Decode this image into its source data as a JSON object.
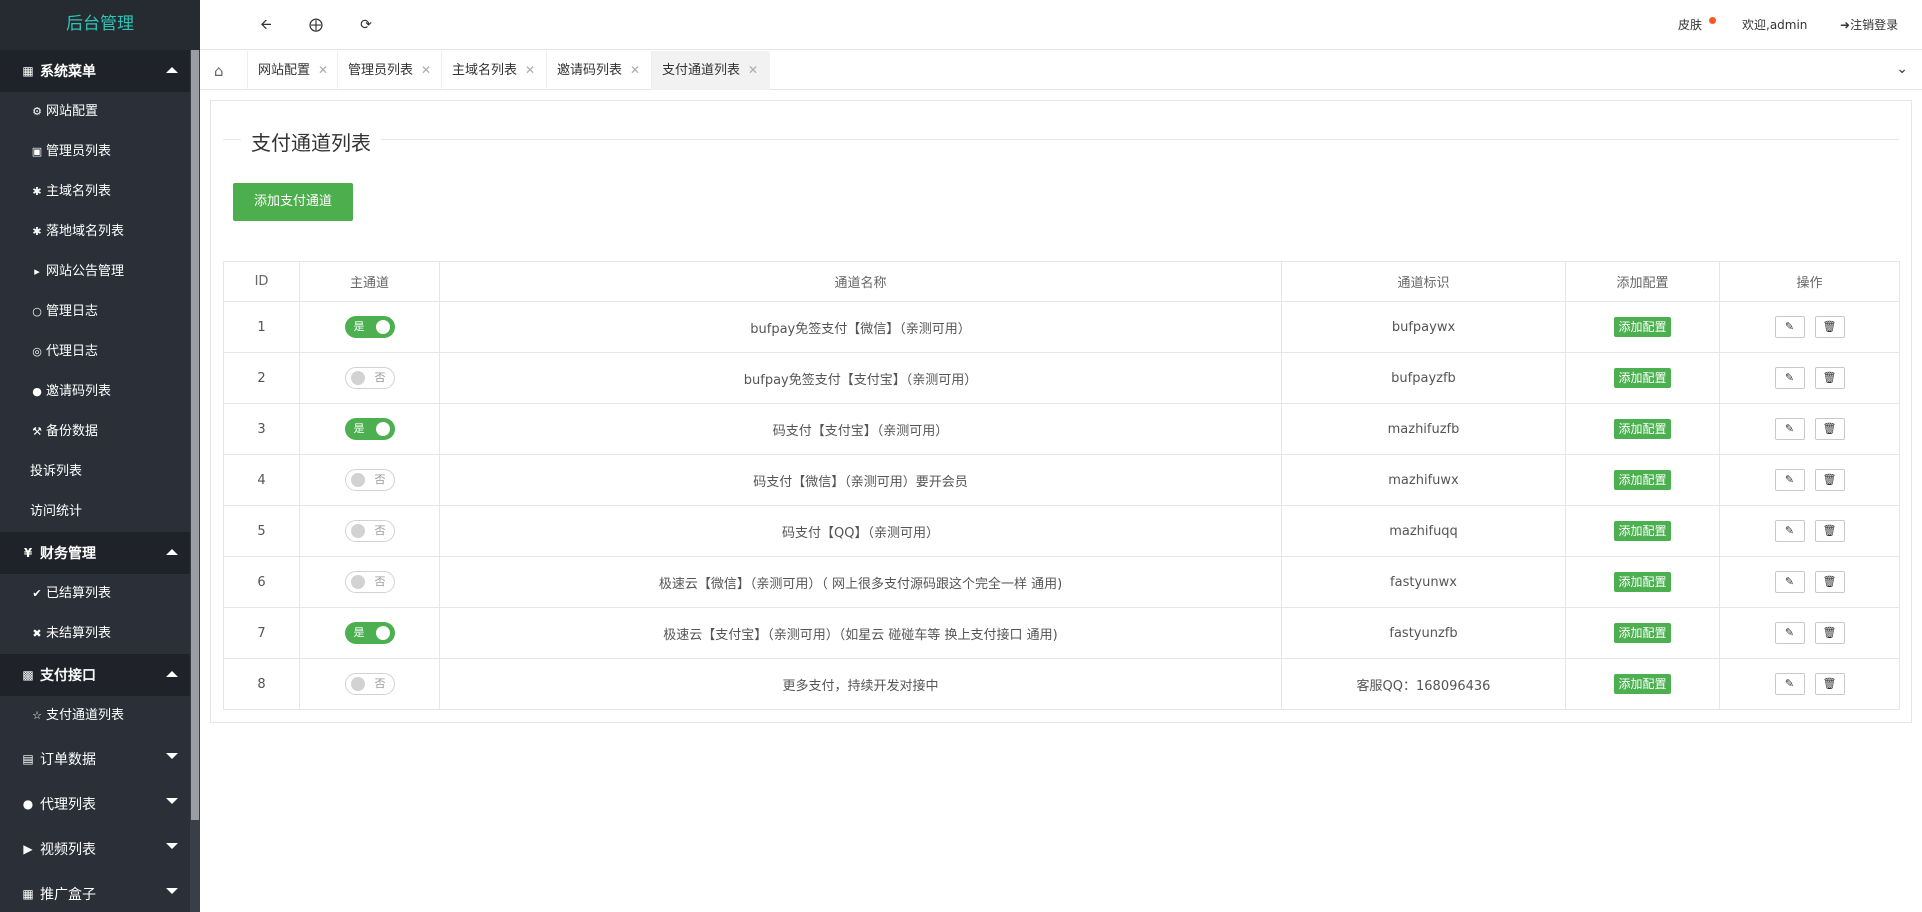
{
  "app": {
    "brand": "后台管理"
  },
  "sidebar": {
    "groups": [
      {
        "label": "系统菜单",
        "icon": "grid-icon",
        "items": [
          {
            "label": "网站配置",
            "icon": "cogs-icon"
          },
          {
            "label": "管理员列表",
            "icon": "lock-icon"
          },
          {
            "label": "主域名列表",
            "icon": "asterisk-icon"
          },
          {
            "label": "落地域名列表",
            "icon": "asterisk-icon"
          },
          {
            "label": "网站公告管理",
            "icon": "bullhorn-icon"
          },
          {
            "label": "管理日志",
            "icon": "comment-icon"
          },
          {
            "label": "代理日志",
            "icon": "comments-icon"
          },
          {
            "label": "邀请码列表",
            "icon": "circle-icon"
          },
          {
            "label": "备份数据",
            "icon": "wrench-icon"
          },
          {
            "label": "投诉列表",
            "icon": ""
          },
          {
            "label": "访问统计",
            "icon": ""
          }
        ]
      },
      {
        "label": "财务管理",
        "icon": "yen-icon",
        "items": [
          {
            "label": "已结算列表",
            "icon": "check-icon"
          },
          {
            "label": "未结算列表",
            "icon": "times-icon"
          }
        ]
      },
      {
        "label": "支付接口",
        "icon": "vimeo-icon",
        "items": [
          {
            "label": "支付通道列表",
            "icon": "star-icon"
          }
        ]
      },
      {
        "label": "订单数据",
        "icon": "bar-chart-icon"
      },
      {
        "label": "代理列表",
        "icon": "users-icon"
      },
      {
        "label": "视频列表",
        "icon": "video-icon"
      },
      {
        "label": "推广盒子",
        "icon": "table-icon"
      }
    ]
  },
  "header": {
    "skin": "皮肤",
    "welcome": "欢迎,admin",
    "logout": "注销登录"
  },
  "tabs": [
    "网站配置",
    "管理员列表",
    "主域名列表",
    "邀请码列表",
    "支付通道列表"
  ],
  "page": {
    "title": "支付通道列表",
    "add_button": "添加支付通道",
    "columns": [
      "ID",
      "主通道",
      "通道名称",
      "通道标识",
      "添加配置",
      "操作"
    ],
    "config_label": "添加配置",
    "switch_on": "是",
    "switch_off": "否",
    "rows": [
      {
        "id": "1",
        "main": true,
        "name": "bufpay免签支付【微信】（亲测可用）",
        "code": "bufpaywx"
      },
      {
        "id": "2",
        "main": false,
        "name": "bufpay免签支付【支付宝】（亲测可用）",
        "code": "bufpayzfb"
      },
      {
        "id": "3",
        "main": true,
        "name": "码支付【支付宝】（亲测可用）",
        "code": "mazhifuzfb"
      },
      {
        "id": "4",
        "main": false,
        "name": "码支付【微信】（亲测可用）要开会员",
        "code": "mazhifuwx"
      },
      {
        "id": "5",
        "main": false,
        "name": "码支付【QQ】（亲测可用）",
        "code": "mazhifuqq"
      },
      {
        "id": "6",
        "main": false,
        "name": "极速云【微信】（亲测可用）（ 网上很多支付源码跟这个完全一样 通用)",
        "code": "fastyunwx"
      },
      {
        "id": "7",
        "main": true,
        "name": "极速云【支付宝】（亲测可用）（如星云 碰碰车等 换上支付接口 通用)",
        "code": "fastyunzfb"
      },
      {
        "id": "8",
        "main": false,
        "name": "更多支付，持续开发对接中",
        "code": "客服QQ：168096436"
      }
    ]
  }
}
